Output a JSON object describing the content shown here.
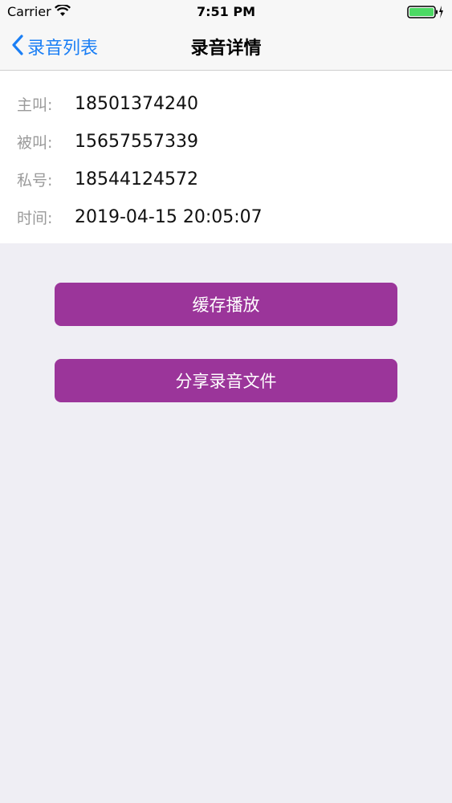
{
  "status_bar": {
    "carrier": "Carrier",
    "time": "7:51 PM",
    "wifi_icon": "wifi-icon",
    "battery_icon": "battery-charging-icon"
  },
  "nav": {
    "back_label": "录音列表",
    "title": "录音详情",
    "back_icon": "chevron-left-icon",
    "accent_color": "#1b7ff5"
  },
  "details": [
    {
      "label": "主叫:",
      "value": "18501374240"
    },
    {
      "label": "被叫:",
      "value": "15657557339"
    },
    {
      "label": "私号:",
      "value": "18544124572"
    },
    {
      "label": "时间:",
      "value": "2019-04-15 20:05:07"
    }
  ],
  "actions": {
    "play_cache_label": "缓存播放",
    "share_label": "分享录音文件",
    "button_color": "#9b359a"
  }
}
